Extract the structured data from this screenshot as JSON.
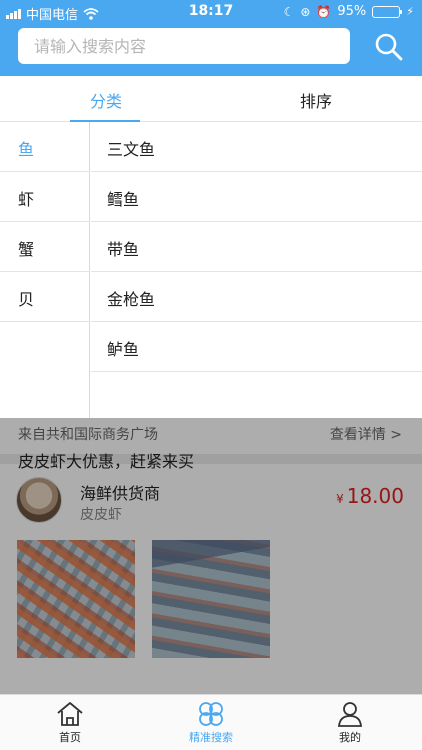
{
  "status_bar": {
    "carrier": "中国电信",
    "time": "18:17",
    "battery": "95%",
    "battery_level": 0.95
  },
  "search": {
    "placeholder": "请输入搜索内容"
  },
  "tabs": {
    "category": "分类",
    "sort": "排序"
  },
  "categories": [
    "鱼",
    "虾",
    "蟹",
    "贝"
  ],
  "subcategories": [
    "三文鱼",
    "鳕鱼",
    "带鱼",
    "金枪鱼",
    "鲈鱼"
  ],
  "background": {
    "source": "来自共和国际商务广场",
    "detail_link": "查看详情 >",
    "seller_name": "海鲜供货商",
    "seller_product": "皮皮虾",
    "currency": "¥",
    "price": "18.00",
    "post_text": "皮皮虾大优惠，赶紧来买"
  },
  "bottom_nav": {
    "home": "首页",
    "search": "精准搜索",
    "mine": "我的"
  },
  "colors": {
    "accent": "#4aa8f0",
    "price": "#e02020"
  }
}
